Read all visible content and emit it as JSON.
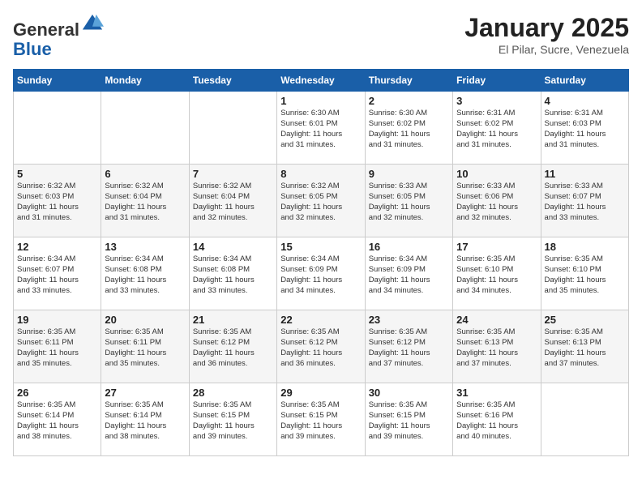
{
  "header": {
    "logo_general": "General",
    "logo_blue": "Blue",
    "month_title": "January 2025",
    "location": "El Pilar, Sucre, Venezuela"
  },
  "days_of_week": [
    "Sunday",
    "Monday",
    "Tuesday",
    "Wednesday",
    "Thursday",
    "Friday",
    "Saturday"
  ],
  "weeks": [
    [
      {
        "day": "",
        "info": ""
      },
      {
        "day": "",
        "info": ""
      },
      {
        "day": "",
        "info": ""
      },
      {
        "day": "1",
        "info": "Sunrise: 6:30 AM\nSunset: 6:01 PM\nDaylight: 11 hours\nand 31 minutes."
      },
      {
        "day": "2",
        "info": "Sunrise: 6:30 AM\nSunset: 6:02 PM\nDaylight: 11 hours\nand 31 minutes."
      },
      {
        "day": "3",
        "info": "Sunrise: 6:31 AM\nSunset: 6:02 PM\nDaylight: 11 hours\nand 31 minutes."
      },
      {
        "day": "4",
        "info": "Sunrise: 6:31 AM\nSunset: 6:03 PM\nDaylight: 11 hours\nand 31 minutes."
      }
    ],
    [
      {
        "day": "5",
        "info": "Sunrise: 6:32 AM\nSunset: 6:03 PM\nDaylight: 11 hours\nand 31 minutes."
      },
      {
        "day": "6",
        "info": "Sunrise: 6:32 AM\nSunset: 6:04 PM\nDaylight: 11 hours\nand 31 minutes."
      },
      {
        "day": "7",
        "info": "Sunrise: 6:32 AM\nSunset: 6:04 PM\nDaylight: 11 hours\nand 32 minutes."
      },
      {
        "day": "8",
        "info": "Sunrise: 6:32 AM\nSunset: 6:05 PM\nDaylight: 11 hours\nand 32 minutes."
      },
      {
        "day": "9",
        "info": "Sunrise: 6:33 AM\nSunset: 6:05 PM\nDaylight: 11 hours\nand 32 minutes."
      },
      {
        "day": "10",
        "info": "Sunrise: 6:33 AM\nSunset: 6:06 PM\nDaylight: 11 hours\nand 32 minutes."
      },
      {
        "day": "11",
        "info": "Sunrise: 6:33 AM\nSunset: 6:07 PM\nDaylight: 11 hours\nand 33 minutes."
      }
    ],
    [
      {
        "day": "12",
        "info": "Sunrise: 6:34 AM\nSunset: 6:07 PM\nDaylight: 11 hours\nand 33 minutes."
      },
      {
        "day": "13",
        "info": "Sunrise: 6:34 AM\nSunset: 6:08 PM\nDaylight: 11 hours\nand 33 minutes."
      },
      {
        "day": "14",
        "info": "Sunrise: 6:34 AM\nSunset: 6:08 PM\nDaylight: 11 hours\nand 33 minutes."
      },
      {
        "day": "15",
        "info": "Sunrise: 6:34 AM\nSunset: 6:09 PM\nDaylight: 11 hours\nand 34 minutes."
      },
      {
        "day": "16",
        "info": "Sunrise: 6:34 AM\nSunset: 6:09 PM\nDaylight: 11 hours\nand 34 minutes."
      },
      {
        "day": "17",
        "info": "Sunrise: 6:35 AM\nSunset: 6:10 PM\nDaylight: 11 hours\nand 34 minutes."
      },
      {
        "day": "18",
        "info": "Sunrise: 6:35 AM\nSunset: 6:10 PM\nDaylight: 11 hours\nand 35 minutes."
      }
    ],
    [
      {
        "day": "19",
        "info": "Sunrise: 6:35 AM\nSunset: 6:11 PM\nDaylight: 11 hours\nand 35 minutes."
      },
      {
        "day": "20",
        "info": "Sunrise: 6:35 AM\nSunset: 6:11 PM\nDaylight: 11 hours\nand 35 minutes."
      },
      {
        "day": "21",
        "info": "Sunrise: 6:35 AM\nSunset: 6:12 PM\nDaylight: 11 hours\nand 36 minutes."
      },
      {
        "day": "22",
        "info": "Sunrise: 6:35 AM\nSunset: 6:12 PM\nDaylight: 11 hours\nand 36 minutes."
      },
      {
        "day": "23",
        "info": "Sunrise: 6:35 AM\nSunset: 6:12 PM\nDaylight: 11 hours\nand 37 minutes."
      },
      {
        "day": "24",
        "info": "Sunrise: 6:35 AM\nSunset: 6:13 PM\nDaylight: 11 hours\nand 37 minutes."
      },
      {
        "day": "25",
        "info": "Sunrise: 6:35 AM\nSunset: 6:13 PM\nDaylight: 11 hours\nand 37 minutes."
      }
    ],
    [
      {
        "day": "26",
        "info": "Sunrise: 6:35 AM\nSunset: 6:14 PM\nDaylight: 11 hours\nand 38 minutes."
      },
      {
        "day": "27",
        "info": "Sunrise: 6:35 AM\nSunset: 6:14 PM\nDaylight: 11 hours\nand 38 minutes."
      },
      {
        "day": "28",
        "info": "Sunrise: 6:35 AM\nSunset: 6:15 PM\nDaylight: 11 hours\nand 39 minutes."
      },
      {
        "day": "29",
        "info": "Sunrise: 6:35 AM\nSunset: 6:15 PM\nDaylight: 11 hours\nand 39 minutes."
      },
      {
        "day": "30",
        "info": "Sunrise: 6:35 AM\nSunset: 6:15 PM\nDaylight: 11 hours\nand 39 minutes."
      },
      {
        "day": "31",
        "info": "Sunrise: 6:35 AM\nSunset: 6:16 PM\nDaylight: 11 hours\nand 40 minutes."
      },
      {
        "day": "",
        "info": ""
      }
    ]
  ]
}
